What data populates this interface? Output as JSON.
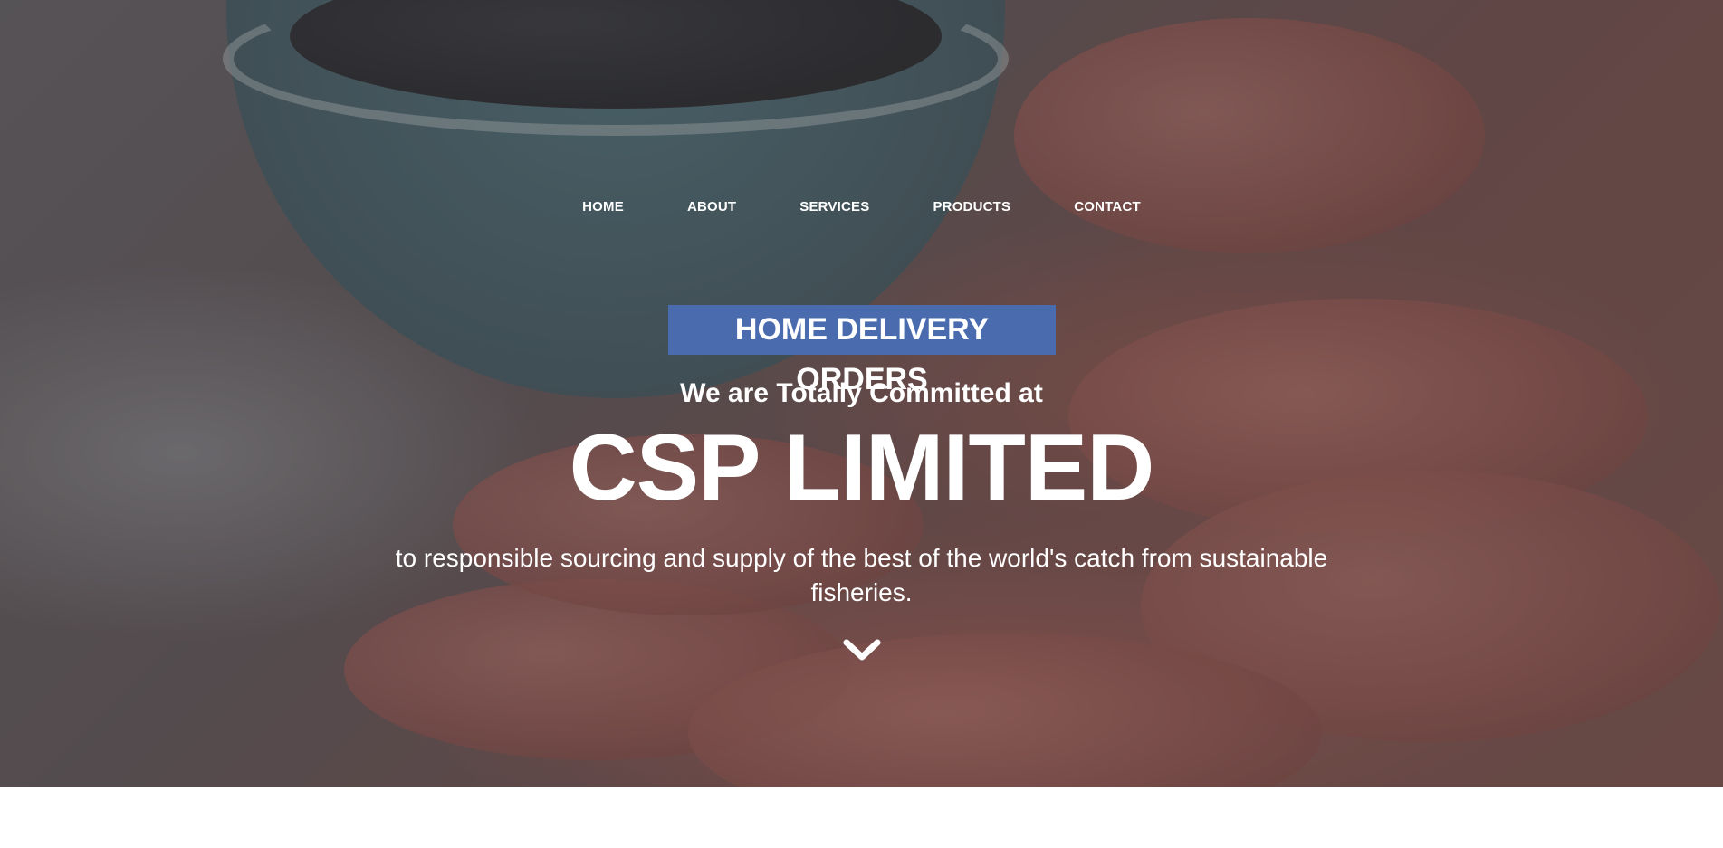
{
  "nav": {
    "items": [
      {
        "label": "HOME"
      },
      {
        "label": "ABOUT"
      },
      {
        "label": "SERVICES"
      },
      {
        "label": "PRODUCTS"
      },
      {
        "label": "CONTACT"
      }
    ]
  },
  "hero": {
    "badge": "HOME DELIVERY ORDERS",
    "subtitle": "We are Totally Committed at",
    "headline": "CSP LIMITED",
    "tagline": "to responsible sourcing and supply of the best of the world's catch from sustainable fisheries.",
    "scroll_icon": "chevron-down-icon"
  },
  "colors": {
    "badge_background": "#4a6cae",
    "text": "#ffffff",
    "page_background": "#ffffff"
  }
}
